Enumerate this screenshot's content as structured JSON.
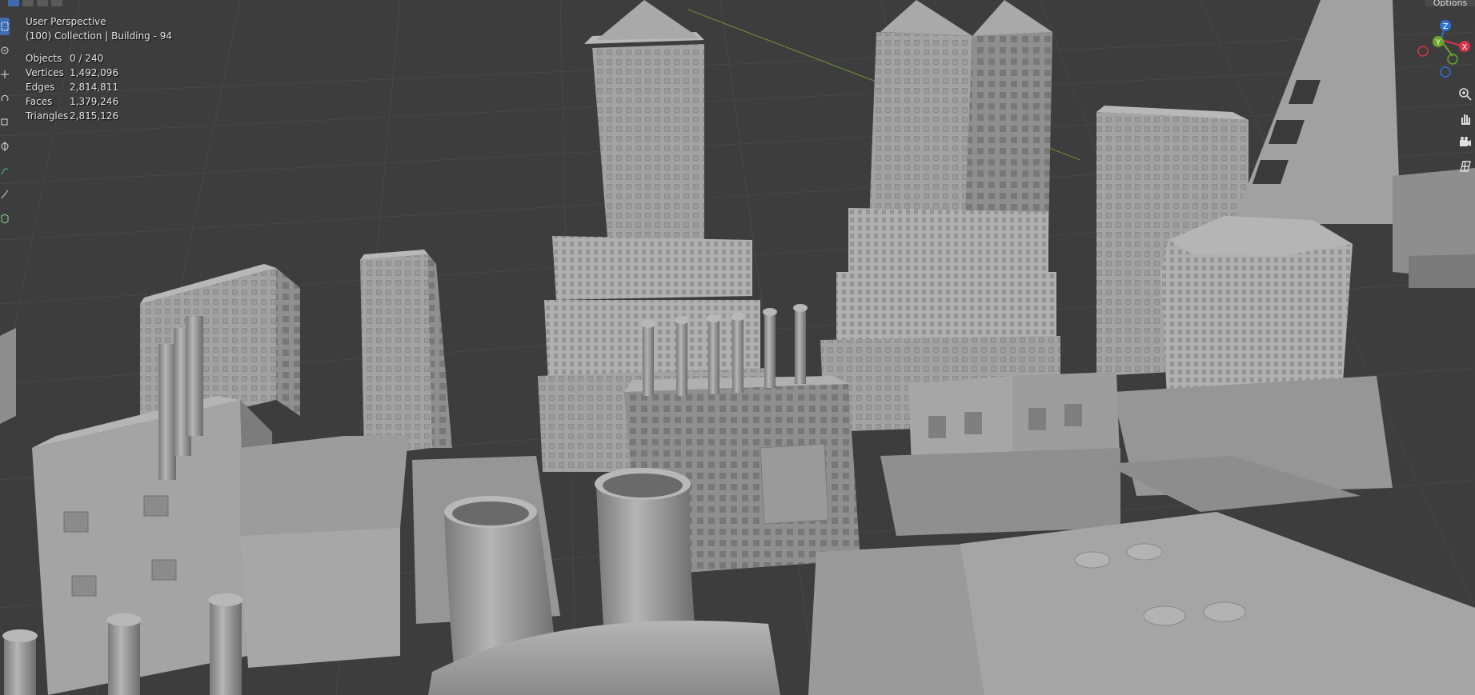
{
  "viewport": {
    "view_name": "User Perspective",
    "collection_label": "(100) Collection | Building - 94",
    "options_label": "Options"
  },
  "stats": [
    {
      "label": "Objects",
      "value": "0 / 240"
    },
    {
      "label": "Vertices",
      "value": "1,492,096"
    },
    {
      "label": "Edges",
      "value": "2,814,811"
    },
    {
      "label": "Faces",
      "value": "1,379,246"
    },
    {
      "label": "Triangles",
      "value": "2,815,126"
    }
  ],
  "gizmo": {
    "axes": [
      {
        "label": "Z",
        "color": "#2e6fd6"
      },
      {
        "label": "Y",
        "color": "#6aa52d"
      },
      {
        "label": "X",
        "color": "#d6324a"
      }
    ]
  },
  "nav_buttons": [
    "zoom-icon",
    "hand-pan-icon",
    "camera-icon",
    "grid-ortho-icon"
  ],
  "toolbar_tools": [
    "select-box-icon",
    "cursor-icon",
    "move-icon",
    "rotate-icon",
    "scale-icon",
    "transform-icon",
    "annotate-icon",
    "measure-icon",
    "add-cube-icon"
  ],
  "colors": {
    "background": "#3d3d3d",
    "grid": "#474747",
    "building_light": "#a9a9a9",
    "building_mid": "#8e8e8e",
    "building_dark": "#6f6f6f",
    "accent_blue": "#3f6bb5",
    "y_axis_line": "#6b8a3a"
  }
}
